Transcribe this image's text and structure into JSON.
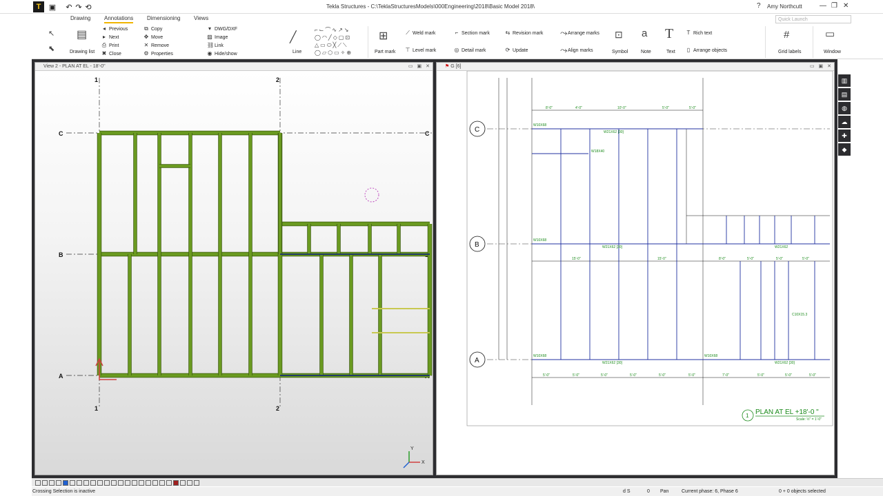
{
  "titlebar": {
    "title": "Tekla Structures - C:\\TeklaStructuresModels\\000Engineering\\2018\\Basic Model 2018\\",
    "user": "Amy Northcutt",
    "help": "?",
    "min": "—",
    "restore": "❐",
    "close": "✕"
  },
  "ribbon": {
    "tabs": [
      "Drawing",
      "Annotations",
      "Dimensioning",
      "Views"
    ],
    "quick_launch_placeholder": "Quick Launch",
    "drawing_list": "Drawing list",
    "nav": {
      "previous": "Previous",
      "next": "Next",
      "print": "Print",
      "close": "Close"
    },
    "edit": {
      "copy": "Copy",
      "move": "Move",
      "remove": "Remove",
      "properties": "Properties"
    },
    "insert": {
      "dwg": "DWG/DXF",
      "image": "Image",
      "link": "Link",
      "hide_show": "Hide/show"
    },
    "line": "Line",
    "part_mark": "Part mark",
    "weld_mark": "Weld mark",
    "level_mark": "Level mark",
    "section_mark": "Section mark",
    "detail_mark": "Detail mark",
    "revision_mark": "Revision mark",
    "update": "Update",
    "arrange_marks": "Arrange marks",
    "align_marks": "Align marks",
    "symbol": "Symbol",
    "note": "Note",
    "text": "Text",
    "rich_text": "Rich text",
    "arrange_objects": "Arrange objects",
    "grid_labels": "Grid labels",
    "window": "Window"
  },
  "view2": {
    "title": "View 2 - PLAN AT EL - 18'-0\"",
    "grid_labels": [
      "1",
      "2",
      "A",
      "B",
      "C"
    ],
    "axis_y": "Y",
    "axis_x": "X"
  },
  "drawing": {
    "title": "G  [6]",
    "grid_bubbles": [
      "C",
      "B",
      "A"
    ],
    "plan_title": "PLAN AT EL  +18'-0  \"",
    "plan_number": "1",
    "scale": "Scale: ½\" = 1'-0\"",
    "dims_top": [
      "8'-0\"",
      "4'-0\"",
      "10'-0\"",
      "5'-0\"",
      "5'-0\""
    ],
    "dims_mid": [
      "15'-0\"",
      "15'-0\"",
      "8'-0\"",
      "5'-0\"",
      "5'-0\"",
      "5'-0\""
    ],
    "dims_bottom": [
      "5'-0\"",
      "5'-0\"",
      "5'-0\"",
      "5'-0\"",
      "5'-0\"",
      "5'-0\"",
      "7'-0\"",
      "5'-0\"",
      "5'-0\"",
      "5'-0\""
    ],
    "beam_labels": [
      "W10X68",
      "W21X62 [30]",
      "W18X40",
      "W21X62 [30]",
      "W10X68",
      "W21X62",
      "W10X68",
      "W21X62 [30]",
      "W10X68",
      "W21X62 [30]",
      "C10X15.3"
    ]
  },
  "statusbar": {
    "message": "Crossing Selection is inactive",
    "snap": "d S",
    "count": "0",
    "mode": "Pan",
    "phase": "Current phase: 6, Phase 6",
    "selected": "0 + 0 objects selected"
  }
}
